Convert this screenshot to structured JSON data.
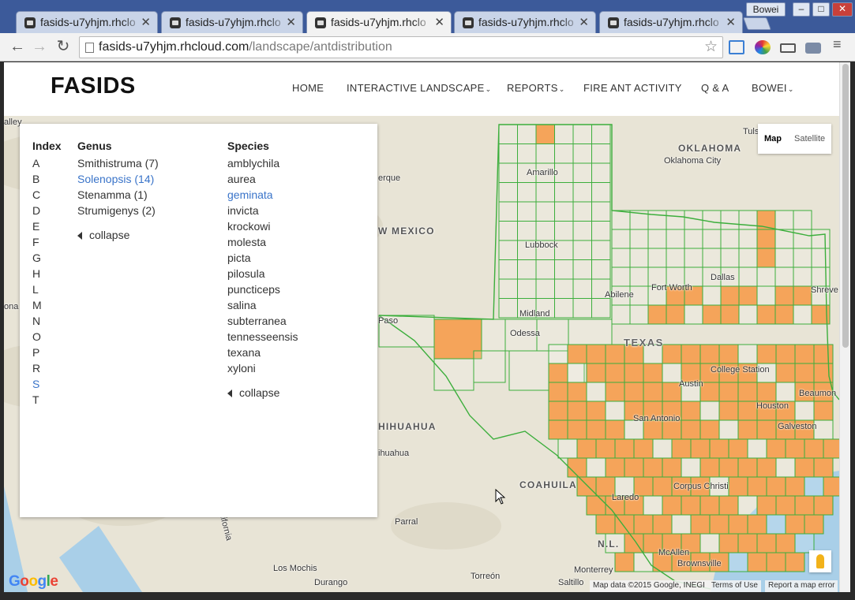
{
  "browser": {
    "profile_name": "Bowei",
    "tabs": [
      {
        "title": "fasids-u7yhjm.rhclo",
        "active": false
      },
      {
        "title": "fasids-u7yhjm.rhclo",
        "active": false
      },
      {
        "title": "fasids-u7yhjm.rhclo",
        "active": true
      },
      {
        "title": "fasids-u7yhjm.rhclo",
        "active": false
      },
      {
        "title": "fasids-u7yhjm.rhclo",
        "active": false
      }
    ],
    "url_host": "fasids-u7yhjm.rhcloud.com",
    "url_path": "/landscape/antdistribution"
  },
  "site": {
    "brand": "FASIDS",
    "nav": [
      {
        "label": "HOME",
        "dropdown": false
      },
      {
        "label": "INTERACTIVE LANDSCAPE",
        "dropdown": true
      },
      {
        "label": "REPORTS",
        "dropdown": true
      },
      {
        "label": "FIRE ANT ACTIVITY",
        "dropdown": false
      },
      {
        "label": "Q & A",
        "dropdown": false
      },
      {
        "label": "BOWEI",
        "dropdown": true
      }
    ]
  },
  "panel": {
    "index_header": "Index",
    "genus_header": "Genus",
    "species_header": "Species",
    "index_items": [
      "A",
      "B",
      "C",
      "D",
      "E",
      "F",
      "G",
      "H",
      "L",
      "M",
      "N",
      "O",
      "P",
      "R",
      "S",
      "T"
    ],
    "index_active": "S",
    "genus_items": [
      "Smithistruma (7)",
      "Solenopsis (14)",
      "Stenamma (1)",
      "Strumigenys (2)"
    ],
    "genus_active": "Solenopsis (14)",
    "species_items": [
      "amblychila",
      "aurea",
      "geminata",
      "invicta",
      "krockowi",
      "molesta",
      "picta",
      "pilosula",
      "puncticeps",
      "salina",
      "subterranea",
      "tennesseensis",
      "texana",
      "xyloni"
    ],
    "species_active": "geminata",
    "collapse_label": "collapse"
  },
  "map": {
    "type_map": "Map",
    "type_satellite": "Satellite",
    "attribution": "Map data ©2015 Google, INEGI",
    "terms": "Terms of Use",
    "report": "Report a map error",
    "google_logo": "Google",
    "labels": {
      "oklahoma": "OKLAHOMA",
      "oklahoma_city": "Oklahoma City",
      "tulsa": "Tuls",
      "amarillo": "Amarillo",
      "lubbock": "Lubbock",
      "new_mexico": "W MEXICO",
      "albuquerque": "erque",
      "dallas": "Dallas",
      "fort_worth": "Fort Worth",
      "abilene": "Abilene",
      "shreveport": "Shreve",
      "midland": "Midland",
      "odessa": "Odessa",
      "el_paso": "Paso",
      "texas": "TEXAS",
      "college_station": "College Station",
      "austin": "Austin",
      "beaumont": "Beaumon",
      "houston": "Houston",
      "galveston": "Galveston",
      "san_antonio": "San Antonio",
      "chihuahua_state": "HIHUAHUA",
      "chihuahua_city": "ihuahua",
      "coahuila": "COAHUILA",
      "laredo": "Laredo",
      "corpus_christi": "Corpus Christi",
      "parral": "Parral",
      "nl": "N.L.",
      "mcallen": "McAllen",
      "brownsville": "Brownsville",
      "monterrey": "Monterrey",
      "saltillo": "Saltillo",
      "torreon": "Torreón",
      "los_mochis": "Los Mochis",
      "durango": "Durango",
      "valley": "alley",
      "ona": "ona",
      "california": "California"
    }
  },
  "colors": {
    "county_border": "#3cae3c",
    "infested_fill": "#f5a45a",
    "map_land": "#e8e4d6",
    "water": "#a9cfe8",
    "link_active": "#3a74c9"
  }
}
